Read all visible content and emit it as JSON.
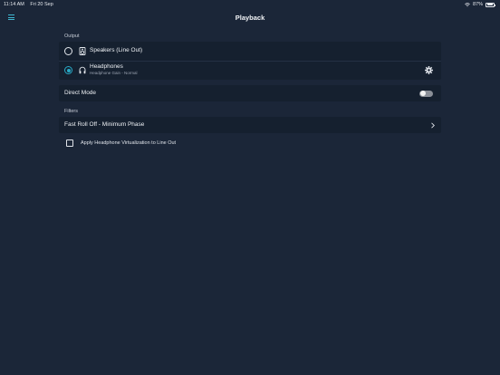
{
  "status": {
    "time": "11:14 AM",
    "date": "Fri 20 Sep",
    "battery": "87%",
    "battery_level": 0.87
  },
  "nav": {
    "title": "Playback",
    "menu_icon": "hamburger-menu-icon"
  },
  "output": {
    "label": "Output",
    "options": [
      {
        "label": "Speakers (Line Out)",
        "selected": false,
        "icon": "speaker-icon"
      },
      {
        "label": "Headphones",
        "sublabel": "Headphone Gain - Normal",
        "selected": true,
        "icon": "headphones-icon",
        "settings_icon": "gear-icon"
      }
    ]
  },
  "direct_mode": {
    "label": "Direct Mode",
    "enabled": false
  },
  "filters": {
    "label": "Filters",
    "current": "Fast Roll Off - Minimum Phase",
    "virtualization_label": "Apply Headphone Virtualization to Line Out",
    "virtualization_checked": false
  },
  "colors": {
    "background": "#1b2638",
    "card": "#15202f",
    "accent": "#29a9c6"
  }
}
